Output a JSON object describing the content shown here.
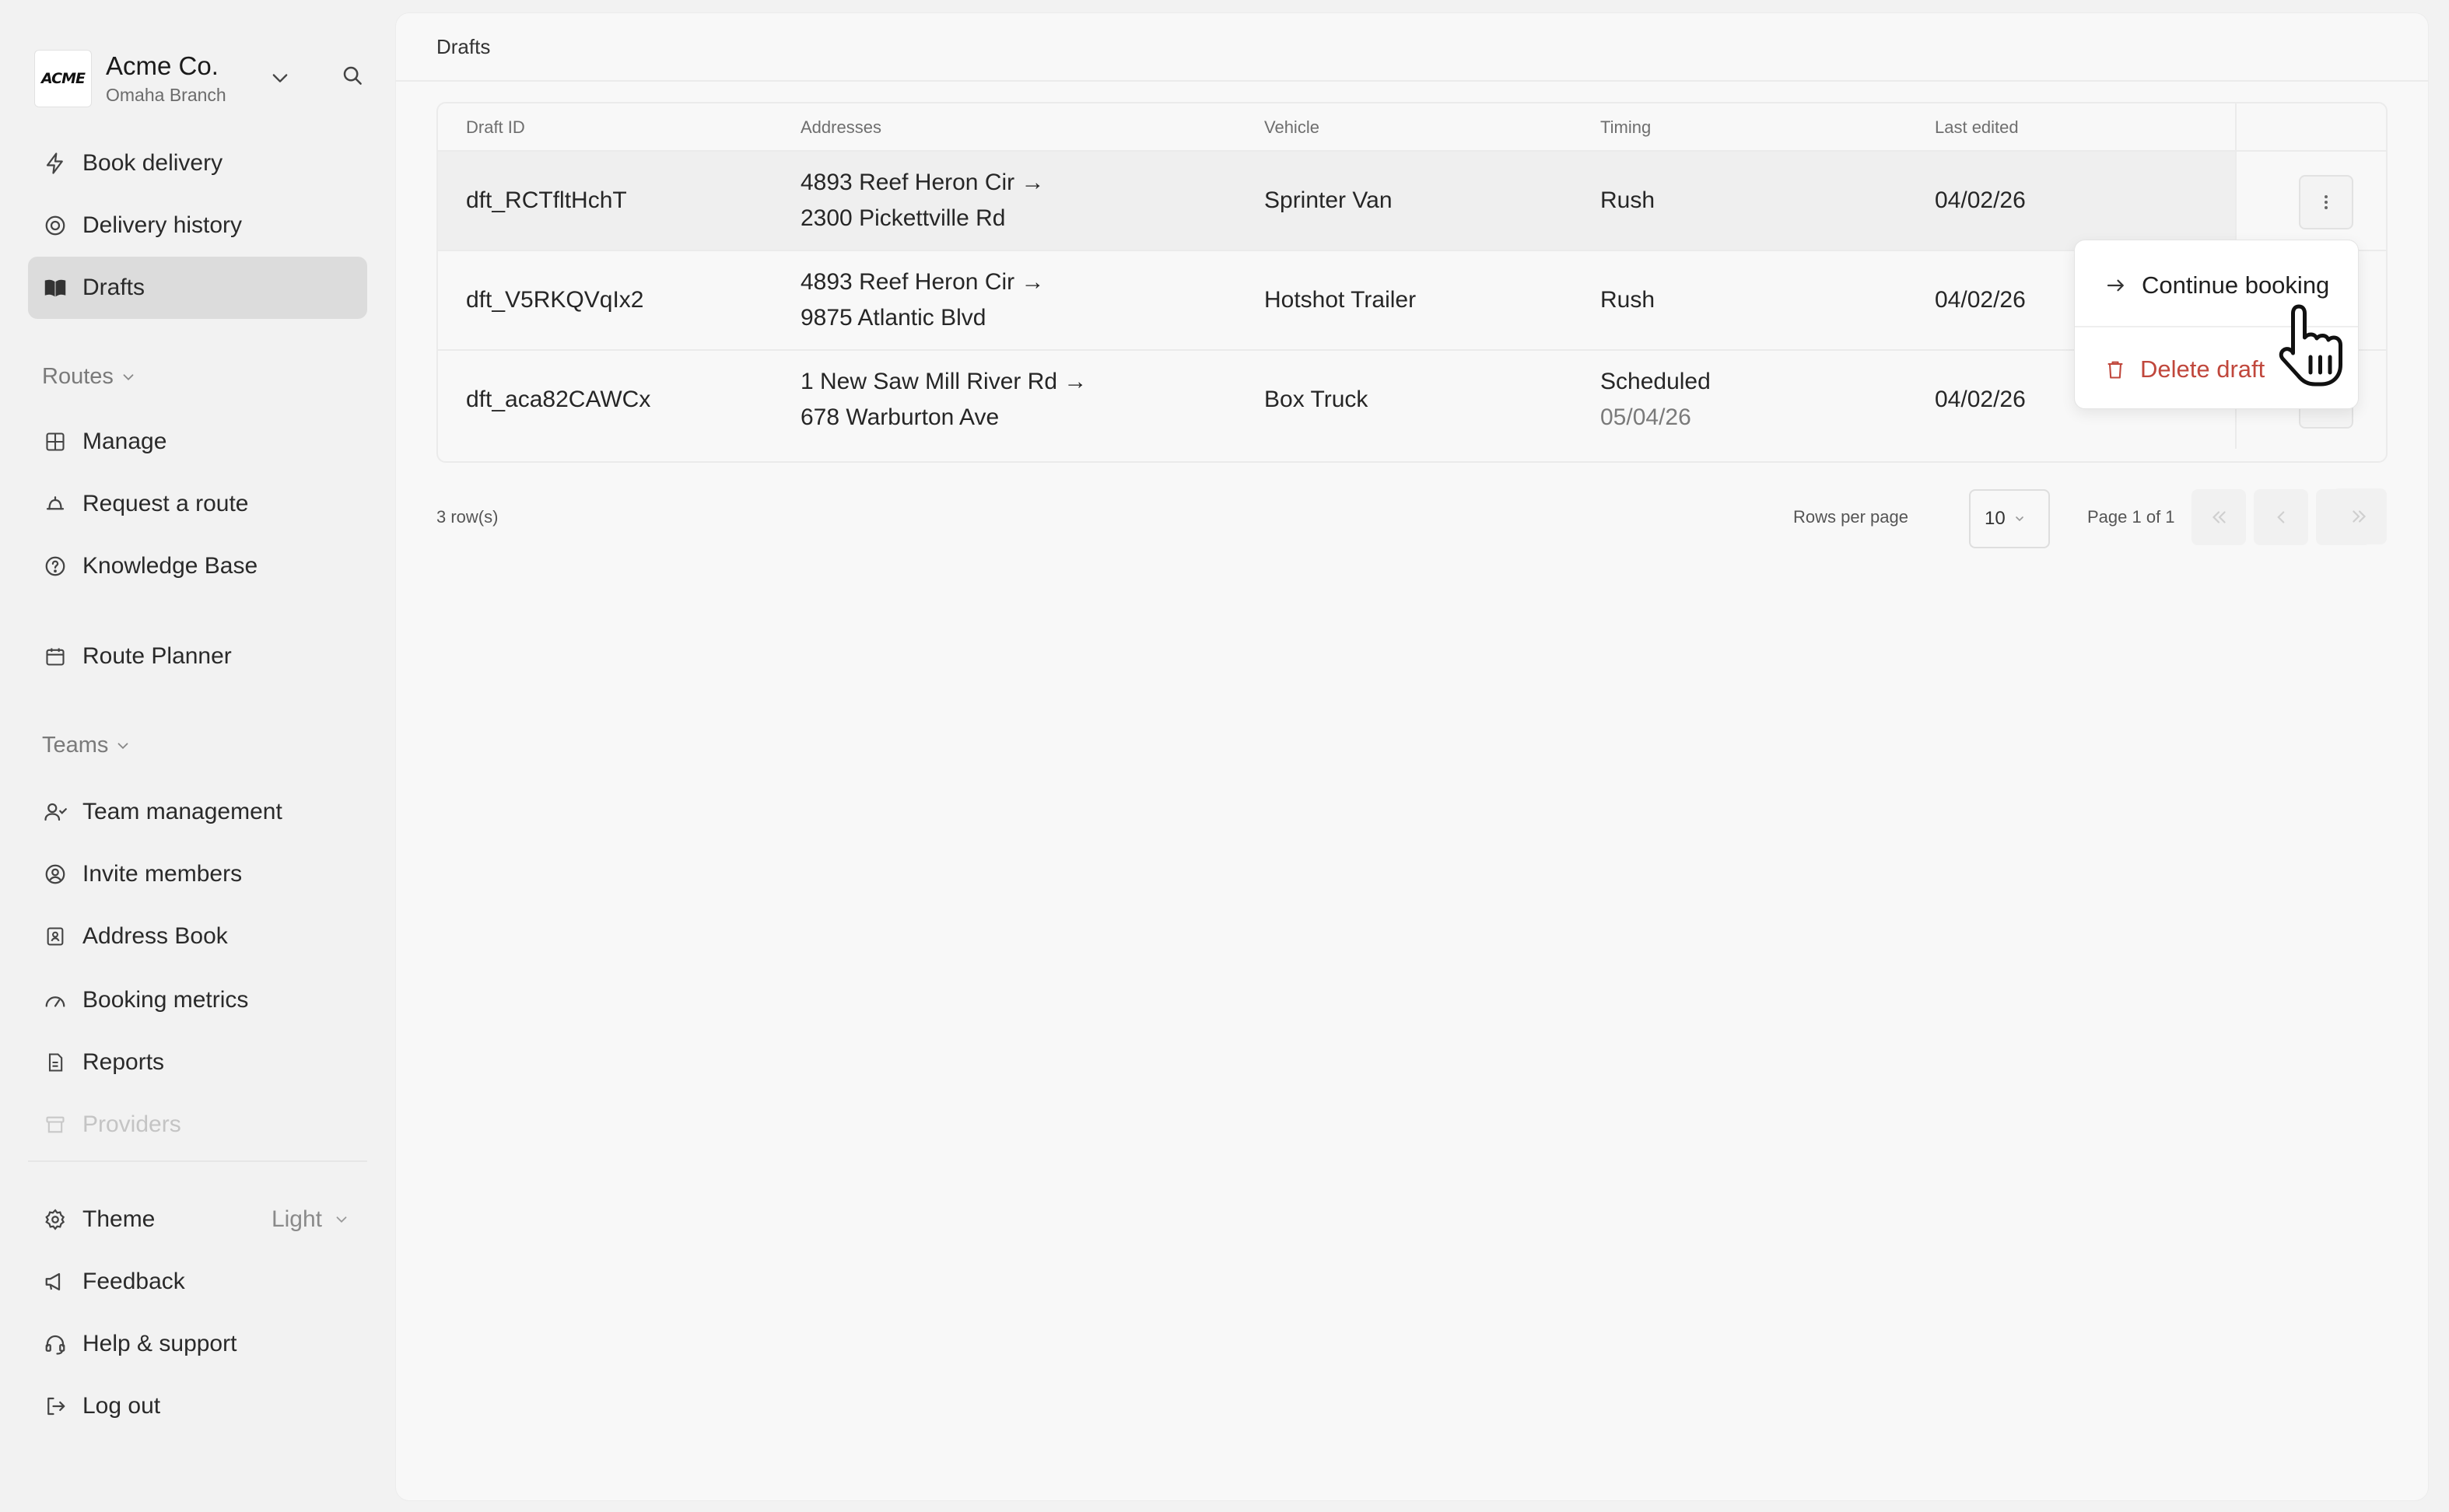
{
  "org": {
    "logo_text": "ACME",
    "name": "Acme Co.",
    "branch": "Omaha Branch"
  },
  "sidebar": {
    "top_items": [
      {
        "label": "Book delivery",
        "icon": "lightning-icon"
      },
      {
        "label": "Delivery history",
        "icon": "target-icon"
      },
      {
        "label": "Drafts",
        "icon": "book-open-icon",
        "active": true
      }
    ],
    "routes_label": "Routes",
    "routes_items": [
      {
        "label": "Manage",
        "icon": "grid-icon"
      },
      {
        "label": "Request a route",
        "icon": "bell-icon"
      },
      {
        "label": "Knowledge Base",
        "icon": "help-circle-icon"
      }
    ],
    "planner_item": {
      "label": "Route Planner",
      "icon": "calendar-icon"
    },
    "teams_label": "Teams",
    "teams_items": [
      {
        "label": "Team management",
        "icon": "users-icon"
      },
      {
        "label": "Invite members",
        "icon": "user-circle-icon"
      },
      {
        "label": "Address Book",
        "icon": "contact-book-icon"
      },
      {
        "label": "Booking metrics",
        "icon": "gauge-icon"
      },
      {
        "label": "Reports",
        "icon": "file-icon"
      },
      {
        "label": "Providers",
        "icon": "archive-icon"
      }
    ],
    "bottom_items": [
      {
        "label": "Theme",
        "icon": "gear-icon",
        "value": "Light"
      },
      {
        "label": "Feedback",
        "icon": "megaphone-icon"
      },
      {
        "label": "Help & support",
        "icon": "headset-icon"
      },
      {
        "label": "Log out",
        "icon": "logout-icon"
      }
    ]
  },
  "main": {
    "breadcrumb": "Drafts",
    "table": {
      "columns": [
        "Draft ID",
        "Addresses",
        "Vehicle",
        "Timing",
        "Last edited"
      ],
      "rows": [
        {
          "id": "dft_RCTfltHchT",
          "from": "4893 Reef Heron Cir →",
          "to": "2300 Pickettville Rd",
          "vehicle": "Sprinter Van",
          "timing": "Rush",
          "timing_date": "",
          "edited": "04/02/26"
        },
        {
          "id": "dft_V5RKQVqIx2",
          "from": "4893 Reef Heron Cir →",
          "to": "9875 Atlantic Blvd",
          "vehicle": "Hotshot Trailer",
          "timing": "Rush",
          "timing_date": "",
          "edited": "04/02/26"
        },
        {
          "id": "dft_aca82CAWCx",
          "from": "1 New Saw Mill River Rd →",
          "to": "678 Warburton Ave",
          "vehicle": "Box Truck",
          "timing": "Scheduled",
          "timing_date": "05/04/26",
          "edited": "04/02/26"
        }
      ]
    },
    "footer": {
      "row_count": "3 row(s)",
      "rows_per_page_label": "Rows per page",
      "rows_per_page_value": "10",
      "page_info": "Page 1 of 1"
    }
  },
  "menu": {
    "continue_label": "Continue booking",
    "delete_label": "Delete draft"
  },
  "colors": {
    "danger": "#c0473c",
    "active_nav": "#dcdcdc"
  }
}
